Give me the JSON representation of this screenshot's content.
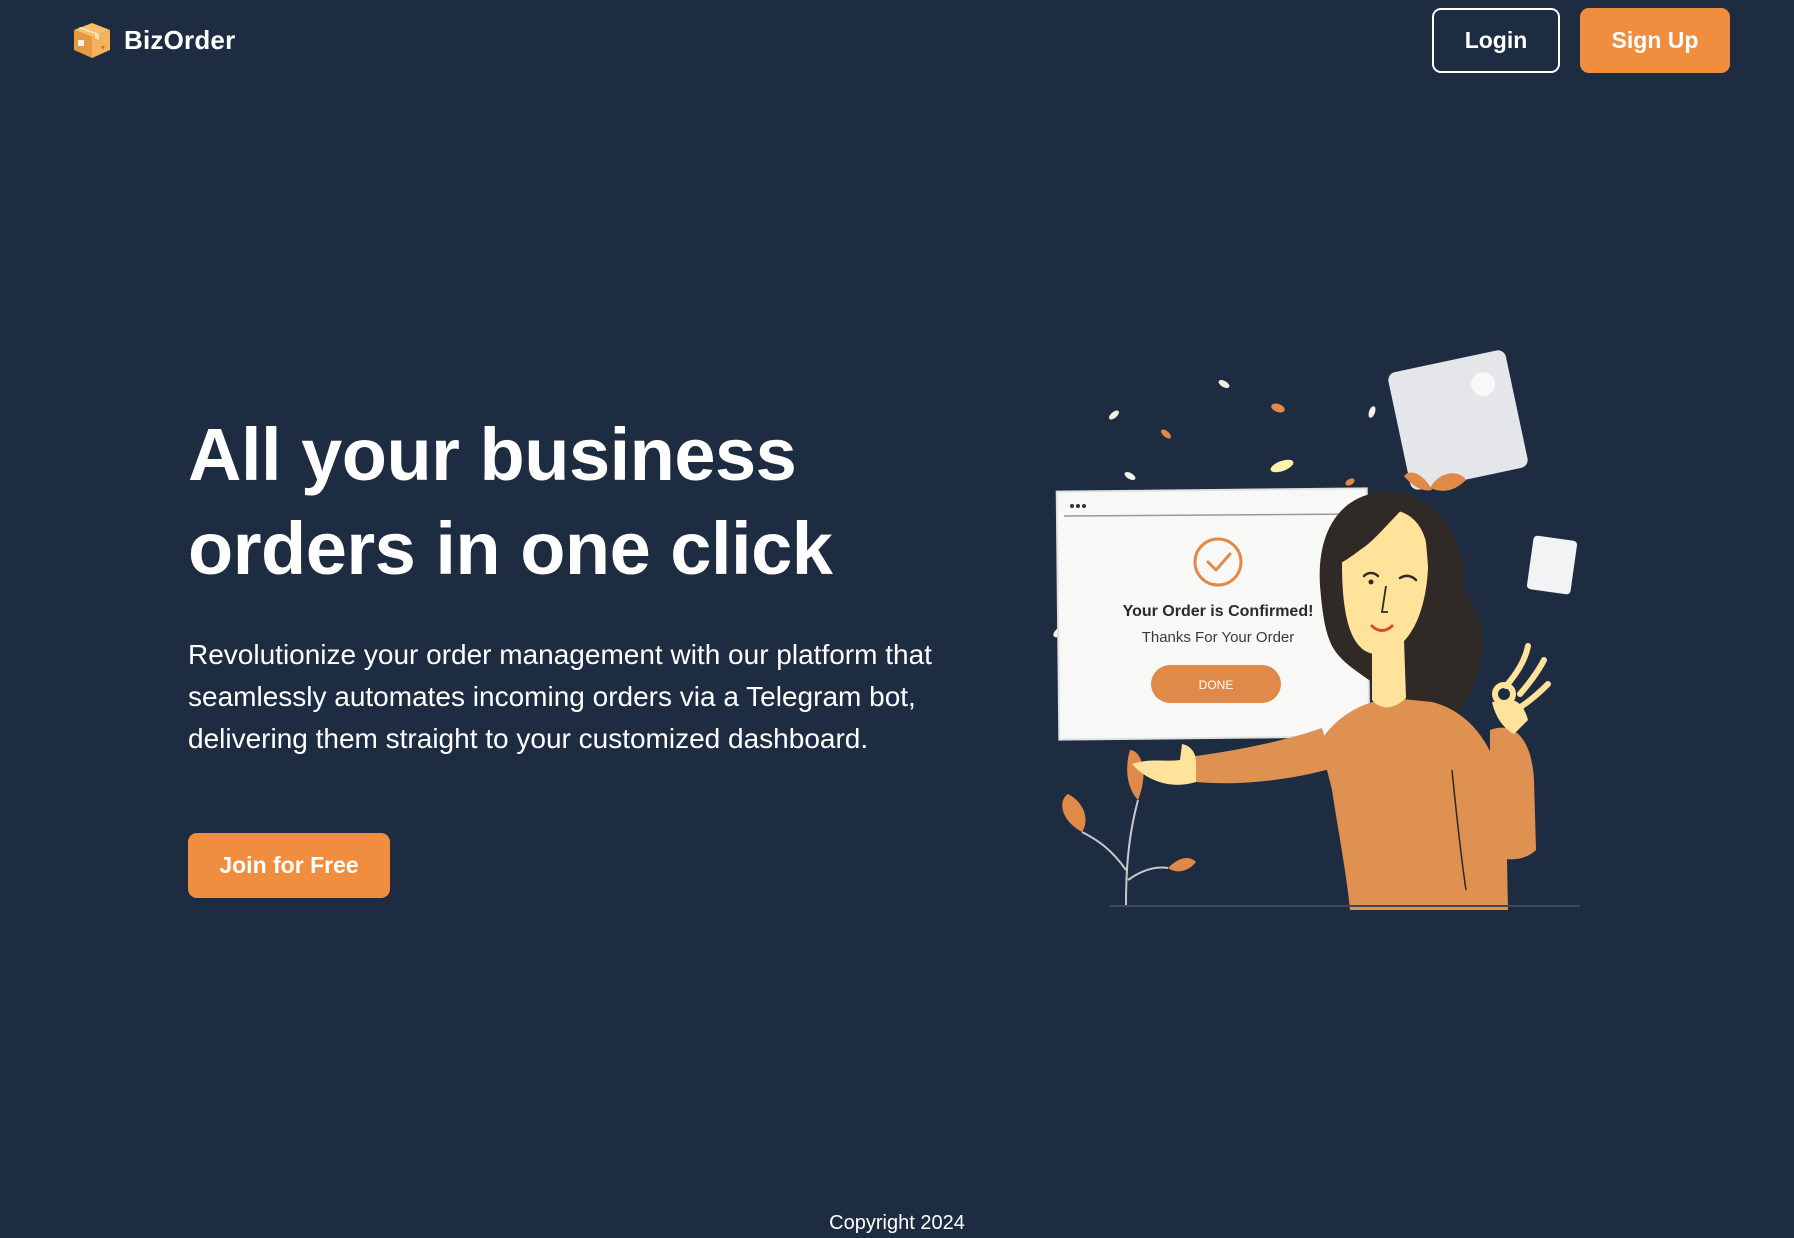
{
  "header": {
    "brand_name": "BizOrder",
    "login_label": "Login",
    "signup_label": "Sign Up"
  },
  "hero": {
    "title_line1": "All your business",
    "title_line2": "orders in one click",
    "description": "Revolutionize your order management with our platform that seamlessly automates incoming orders via a Telegram bot, delivering them straight to your customized dashboard.",
    "cta_label": "Join for Free"
  },
  "illustration": {
    "card_title": "Your Order is Confirmed!",
    "card_subtitle": "Thanks For Your Order",
    "card_button": "DONE"
  },
  "footer": {
    "copyright": "Copyright 2024"
  },
  "colors": {
    "background": "#1e2c42",
    "accent": "#f18d3f",
    "text": "#ffffff"
  },
  "icons": {
    "logo": "package-box-icon",
    "confirm": "check-circle-icon"
  }
}
